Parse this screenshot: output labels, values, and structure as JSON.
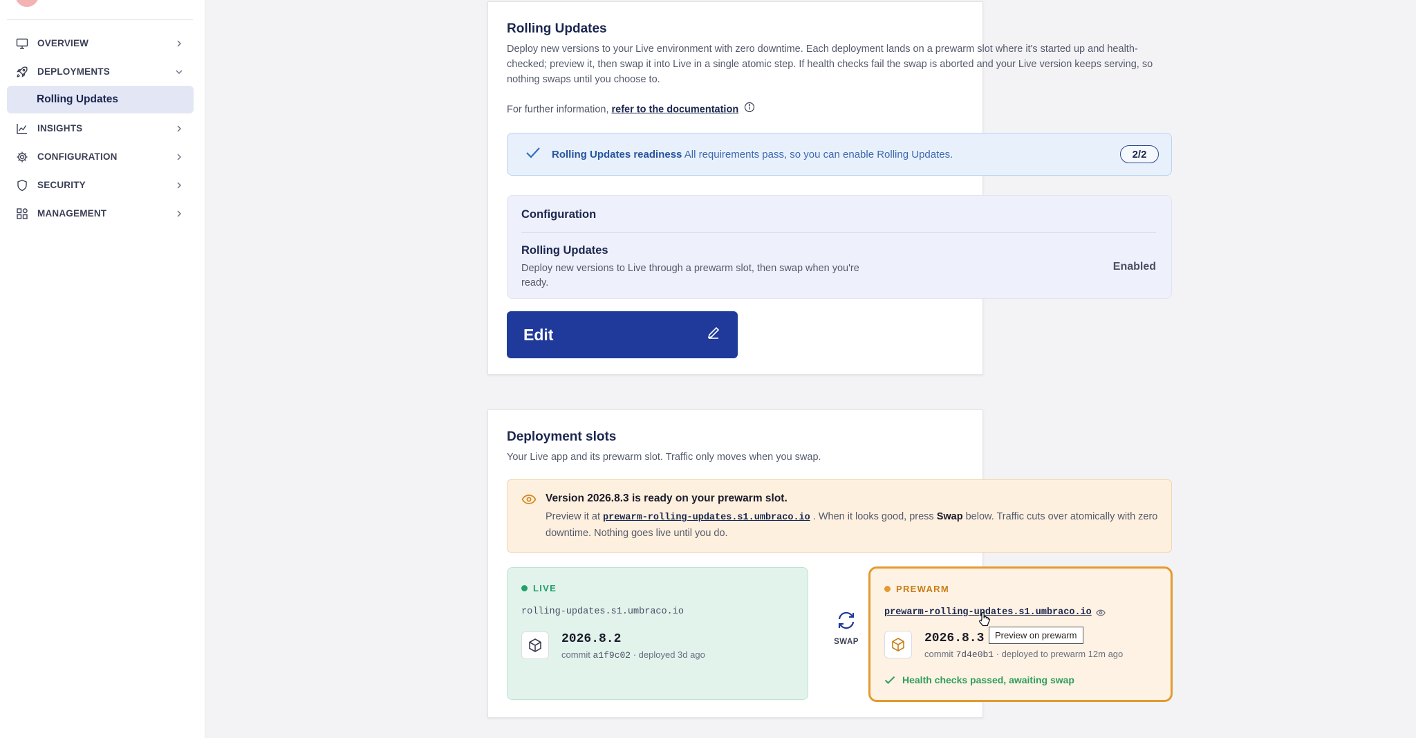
{
  "sidebar": {
    "items": [
      {
        "label": "OVERVIEW",
        "icon": "monitor-icon",
        "chevron": "chevron-right-icon"
      },
      {
        "label": "DEPLOYMENTS",
        "icon": "rocket-icon",
        "chevron": "chevron-down-icon"
      },
      {
        "label": "INSIGHTS",
        "icon": "chart-icon",
        "chevron": "chevron-right-icon"
      },
      {
        "label": "CONFIGURATION",
        "icon": "gear-icon",
        "chevron": "chevron-right-icon"
      },
      {
        "label": "SECURITY",
        "icon": "shield-icon",
        "chevron": "chevron-right-icon"
      },
      {
        "label": "MANAGEMENT",
        "icon": "grid-icon",
        "chevron": "chevron-right-icon"
      }
    ],
    "active_sub": "Rolling Updates"
  },
  "rolling": {
    "title": "Rolling Updates",
    "description": "Deploy new versions to your Live environment with zero downtime. Each deployment lands on a prewarm slot where it's started up and health-checked; preview it, then swap it into Live in a single atomic step. If health checks fail the swap is aborted and your Live version keeps serving, so nothing swaps until you choose to.",
    "further_prefix": "For further information, ",
    "doc_link": "refer to the documentation",
    "readiness": {
      "title": "Rolling Updates readiness",
      "text": " All requirements pass, so you can enable Rolling Updates.",
      "count": "2/2"
    },
    "config": {
      "heading": "Configuration",
      "row_title": "Rolling Updates",
      "row_desc": "Deploy new versions to Live through a prewarm slot, then swap when you're ready.",
      "row_value": "Enabled"
    },
    "edit_label": "Edit"
  },
  "slots": {
    "title": "Deployment slots",
    "subtitle": "Your Live app and its prewarm slot. Traffic only moves when you swap.",
    "banner": {
      "title": "Version 2026.8.3 is ready on your prewarm slot.",
      "pre": "Preview it at ",
      "url": "prewarm-rolling-updates.s1.umbraco.io",
      "mid": " . When it looks good, press ",
      "swap_word": "Swap",
      "post": " below. Traffic cuts over atomically with zero downtime. Nothing goes live until you do."
    },
    "live": {
      "tag": "LIVE",
      "url": "rolling-updates.s1.umbraco.io",
      "version": "2026.8.2",
      "commit_prefix": "commit ",
      "commit": "a1f9c02",
      "deployed": " · deployed 3d ago"
    },
    "swap_label": "SWAP",
    "prewarm": {
      "tag": "PREWARM",
      "url": "prewarm-rolling-updates.s1.umbraco.io",
      "version": "2026.8.3",
      "commit_prefix": "commit ",
      "commit": "7d4e0b1",
      "deployed": " · deployed to prewarm 12m ago",
      "health": "Health checks passed, awaiting swap"
    },
    "tooltip": "Preview on prewarm"
  },
  "colors": {
    "primary": "#1f3a9a",
    "live_green": "#22a06b",
    "prewarm_orange": "#e39a2f",
    "health_green": "#2f9e5e"
  }
}
